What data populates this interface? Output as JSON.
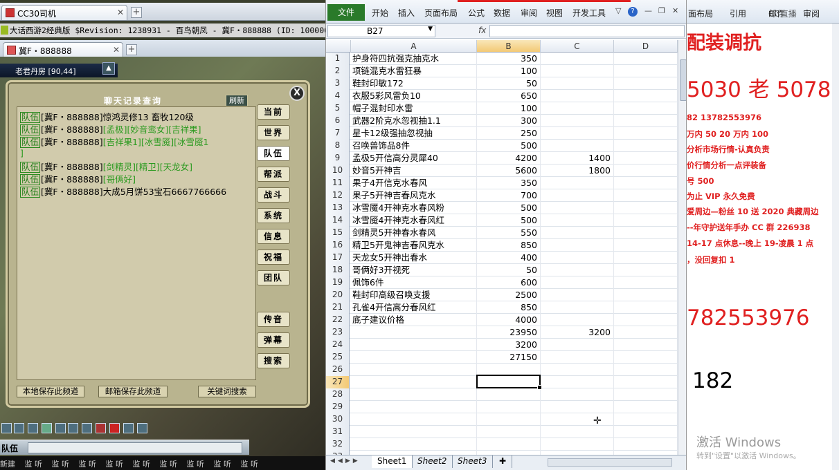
{
  "game": {
    "browser_tab1": "CC30司机",
    "browser_tab2": "冀F・888888",
    "window_title": "大话西游2经典版 $Revision: 1238931 - 百鸟朝凤 - 冀F・888888 (ID: 10000008)",
    "location": "老君丹房 [90,44]",
    "chat_title": "聊天记录查询",
    "refresh": "刷新",
    "close": "X",
    "lines": [
      {
        "tag": "队伍",
        "name": "[冀F・888888]",
        "text": "惊鸿灵修13 畜牧120级",
        "green": false
      },
      {
        "tag": "队伍",
        "name": "[冀F・888888]",
        "text": "[孟极][妙音鸾女][吉祥果]",
        "green": true
      },
      {
        "tag": "队伍",
        "name": "[冀F・888888]",
        "text": "[吉祥果1][冰雪魇][冰雪魇1",
        "green": true
      },
      {
        "tag": "",
        "name": "",
        "text": "]",
        "green": true
      },
      {
        "tag": "队伍",
        "name": "[冀F・888888]",
        "text": "[剑精灵][精卫][天龙女]",
        "green": true
      },
      {
        "tag": "队伍",
        "name": "[冀F・888888]",
        "text": "[哥俩好]",
        "green": true
      },
      {
        "tag": "队伍",
        "name": "[冀F・888888]",
        "text": "大成5月饼53宝石6667766666",
        "green": false
      }
    ],
    "channels": [
      "当前",
      "世界",
      "队伍",
      "帮派",
      "战斗",
      "系统",
      "信息",
      "祝福",
      "团队",
      "传音",
      "弹幕",
      "搜索"
    ],
    "btn_local_save": "本地保存此频道",
    "btn_mail_save": "邮箱保存此频道",
    "btn_keyword": "关键词搜索",
    "input_channel": "队伍",
    "status": [
      "新建",
      "监 听",
      "监 听",
      "监 听",
      "监 听",
      "监 听",
      "监 听",
      "监 听",
      "监 听",
      "监 听"
    ]
  },
  "excel": {
    "file_tab": "文件",
    "tabs": [
      "开始",
      "插入",
      "页面布局",
      "公式",
      "数据",
      "审阅",
      "视图",
      "开发工具"
    ],
    "namebox": "B27",
    "fx": "fx",
    "columns": [
      "A",
      "B",
      "C",
      "D"
    ],
    "rows": [
      {
        "n": "1",
        "a": "护身符四抗强克抽克水",
        "b": "350",
        "c": ""
      },
      {
        "n": "2",
        "a": "项链混克水雷狂暴",
        "b": "100",
        "c": ""
      },
      {
        "n": "3",
        "a": "鞋封印敏172",
        "b": "50",
        "c": ""
      },
      {
        "n": "4",
        "a": "衣服5彩风雷负10",
        "b": "650",
        "c": ""
      },
      {
        "n": "5",
        "a": "帽子混封印水雷",
        "b": "100",
        "c": ""
      },
      {
        "n": "6",
        "a": "武器2阶克水忽视抽1.1",
        "b": "300",
        "c": ""
      },
      {
        "n": "7",
        "a": "星卡12级强抽忽视抽",
        "b": "250",
        "c": ""
      },
      {
        "n": "8",
        "a": "召唤兽饰品8件",
        "b": "500",
        "c": ""
      },
      {
        "n": "9",
        "a": "孟极5开信高分灵犀40",
        "b": "4200",
        "c": "1400"
      },
      {
        "n": "10",
        "a": "妙音5开神吉",
        "b": "5600",
        "c": "1800"
      },
      {
        "n": "11",
        "a": "果子4开信克水春风",
        "b": "350",
        "c": ""
      },
      {
        "n": "12",
        "a": "果子5开神吉春风克水",
        "b": "700",
        "c": ""
      },
      {
        "n": "13",
        "a": "冰雪魇4开神克水春风粉",
        "b": "500",
        "c": ""
      },
      {
        "n": "14",
        "a": "冰雪魇4开神克水春风红",
        "b": "500",
        "c": ""
      },
      {
        "n": "15",
        "a": "剑精灵5开神春水春风",
        "b": "550",
        "c": ""
      },
      {
        "n": "16",
        "a": "精卫5开鬼神吉春风克水",
        "b": "850",
        "c": ""
      },
      {
        "n": "17",
        "a": "天龙女5开神出春水",
        "b": "400",
        "c": ""
      },
      {
        "n": "18",
        "a": "哥俩好3开视死",
        "b": "50",
        "c": ""
      },
      {
        "n": "19",
        "a": "佩饰6件",
        "b": "600",
        "c": ""
      },
      {
        "n": "20",
        "a": "鞋封印高级召唤支援",
        "b": "2500",
        "c": ""
      },
      {
        "n": "21",
        "a": "孔雀4开信高分春风红",
        "b": "850",
        "c": ""
      },
      {
        "n": "22",
        "a": "底子建议价格",
        "b": "4000",
        "c": ""
      },
      {
        "n": "23",
        "a": "",
        "b": "23950",
        "c": "3200"
      },
      {
        "n": "24",
        "a": "",
        "b": "3200",
        "c": ""
      },
      {
        "n": "25",
        "a": "",
        "b": "27150",
        "c": ""
      },
      {
        "n": "26",
        "a": "",
        "b": "",
        "c": ""
      },
      {
        "n": "27",
        "a": "",
        "b": "",
        "c": ""
      },
      {
        "n": "28",
        "a": "",
        "b": "",
        "c": ""
      },
      {
        "n": "29",
        "a": "",
        "b": "",
        "c": ""
      },
      {
        "n": "30",
        "a": "",
        "b": "",
        "c": ""
      },
      {
        "n": "31",
        "a": "",
        "b": "",
        "c": ""
      },
      {
        "n": "32",
        "a": "",
        "b": "",
        "c": ""
      },
      {
        "n": "33",
        "a": "",
        "b": "",
        "c": ""
      }
    ],
    "sheets": [
      "Sheet1",
      "Sheet2",
      "Sheet3"
    ]
  },
  "word": {
    "tabs": [
      "面布局",
      "引用",
      "邮件",
      "审阅"
    ],
    "logo": "CC直播",
    "lines": [
      "配装调抗",
      "5030 老 5078",
      "82    13782553976",
      "万内 50  20 万内 100",
      "分析市场行情-认真负责",
      "价行情分析一点评装备",
      "号 500",
      "为止    VIP 永久免费",
      "爱周边—粉丝 10 送 2020 典藏周边",
      "--年守护送年手办    CC 群 226938",
      "14-17 点休息--晚上 19-凌晨 1 点",
      "，没回复扣 1",
      "782553976",
      "182"
    ],
    "activate_title": "激活 Windows",
    "activate_sub": "转到\"设置\"以激活 Windows。"
  }
}
